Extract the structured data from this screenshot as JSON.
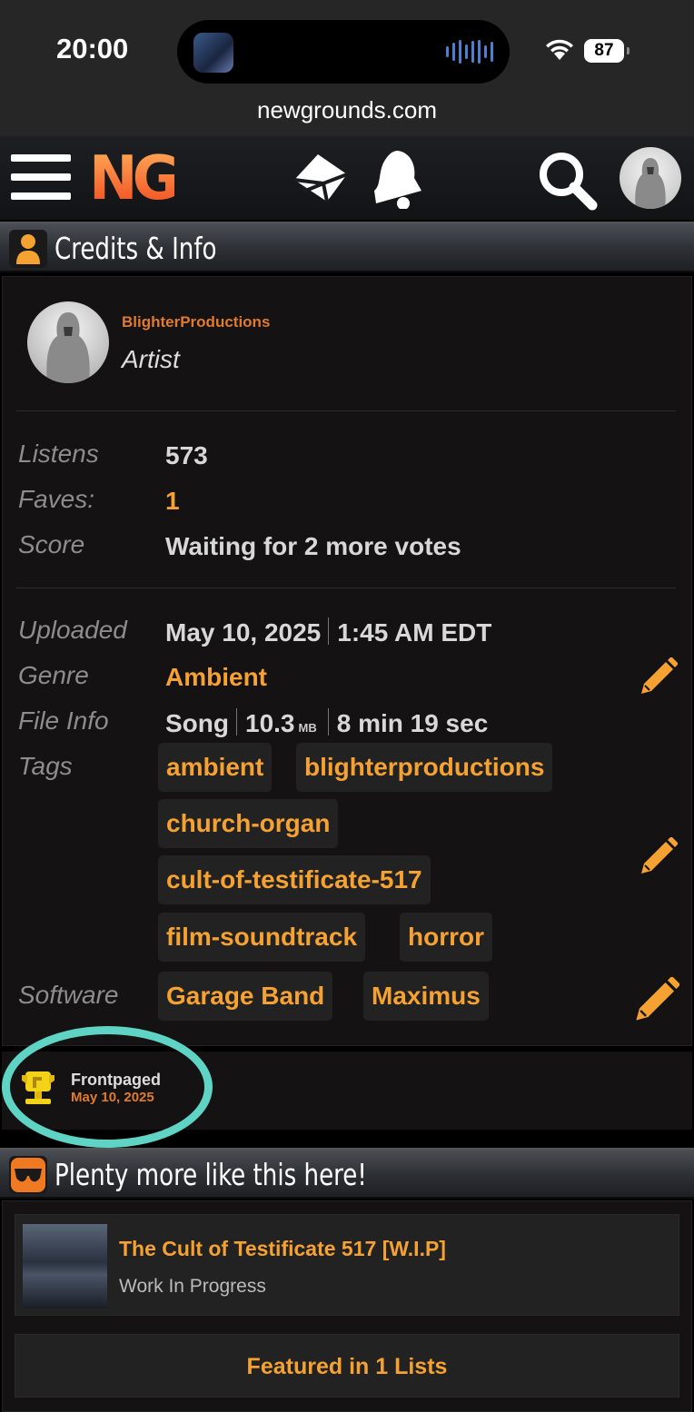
{
  "status_bar": {
    "time": "20:00",
    "battery": "87"
  },
  "browser": {
    "url": "newgrounds.com"
  },
  "nav": {
    "logo": "NG",
    "icons": [
      "menu-icon",
      "mail-icon",
      "bell-icon",
      "search-icon",
      "user-avatar"
    ]
  },
  "credits": {
    "header": "Credits & Info",
    "artist": {
      "name": "BlighterProductions",
      "role": "Artist"
    },
    "stats": {
      "listens_label": "Listens",
      "listens": "573",
      "faves_label": "Faves:",
      "faves": "1",
      "score_label": "Score",
      "score": "Waiting for 2 more votes"
    },
    "info": {
      "uploaded_label": "Uploaded",
      "upload_date": "May 10, 2025",
      "upload_time": "1:45 AM EDT",
      "genre_label": "Genre",
      "genre": "Ambient",
      "fileinfo_label": "File Info",
      "file_type": "Song",
      "file_size": "10.3",
      "file_unit": "MB",
      "duration": "8 min 19 sec",
      "tags_label": "Tags",
      "tags": [
        "ambient",
        "blighterproductions",
        "church-organ",
        "cult-of-testificate-517",
        "film-soundtrack",
        "horror"
      ],
      "software_label": "Software",
      "software": [
        "Garage Band",
        "Maximus"
      ]
    },
    "award": {
      "title": "Frontpaged",
      "date": "May 10, 2025"
    }
  },
  "more": {
    "header": "Plenty more like this here!",
    "item": {
      "title": "The Cult of Testificate 517 [W.I.P]",
      "subtitle": "Work In Progress"
    },
    "featured": "Featured in 1 Lists"
  },
  "colors": {
    "accent": "#f6a232",
    "link": "#e07a2c",
    "highlight_circle": "#5fd4c4"
  }
}
